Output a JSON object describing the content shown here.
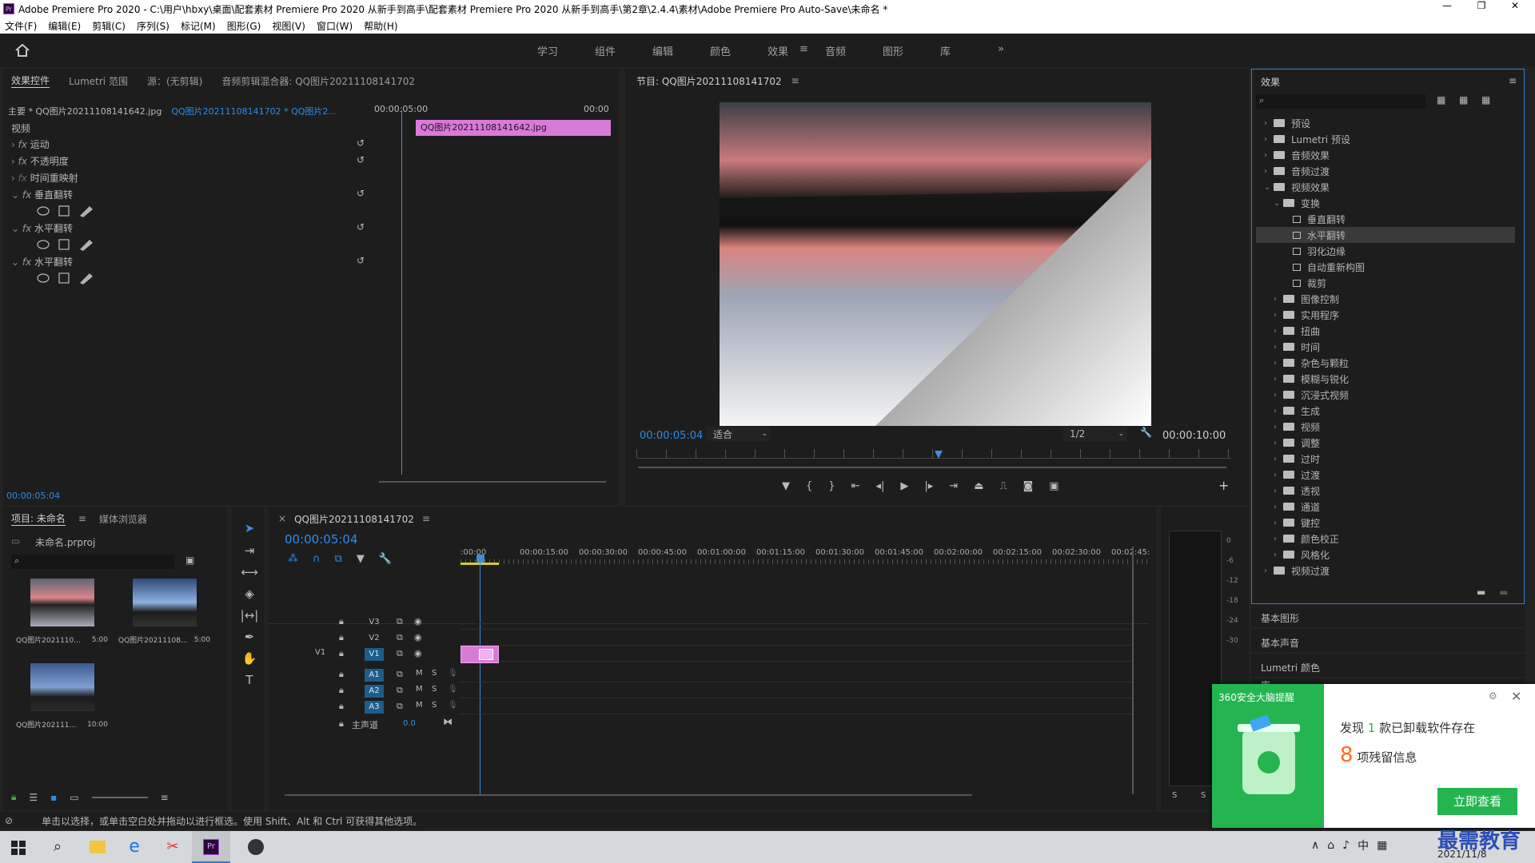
{
  "app": {
    "title": "Adobe Premiere Pro 2020 - C:\\用户\\hbxy\\桌面\\配套素材 Premiere Pro 2020 从新手到高手\\配套素材 Premiere Pro 2020 从新手到高手\\第2章\\2.4.4\\素材\\Adobe Premiere Pro Auto-Save\\未命名 *",
    "icon_label": "Pr"
  },
  "menu": [
    "文件(F)",
    "编辑(E)",
    "剪辑(C)",
    "序列(S)",
    "标记(M)",
    "图形(G)",
    "视图(V)",
    "窗口(W)",
    "帮助(H)"
  ],
  "workspaces": [
    "学习",
    "组件",
    "编辑",
    "颜色",
    "效果",
    "音频",
    "图形",
    "库"
  ],
  "active_workspace": "效果",
  "effect_controls": {
    "tabs": [
      "效果控件",
      "Lumetri 范围",
      "源：(无剪辑)",
      "音频剪辑混合器: QQ图片20211108141702"
    ],
    "master": "主要 * QQ图片20211108141642.jpg",
    "sequence": "QQ图片20211108141702 * QQ图片2...",
    "ruler_start": "00:00:05:00",
    "ruler_end": "00:00",
    "clip_name": "QQ图片20211108141642.jpg",
    "section": "视频",
    "effects": [
      "运动",
      "不透明度",
      "时间重映射",
      "垂直翻转",
      "水平翻转",
      "水平翻转"
    ],
    "timecode": "00:00:05:04"
  },
  "program": {
    "title": "节目: QQ图片20211108141702",
    "timecode": "00:00:05:04",
    "fit": "适合",
    "quality": "1/2",
    "duration": "00:00:10:00",
    "playhead_fraction": 0.508
  },
  "effects_panel": {
    "title": "效果",
    "search_placeholder": "",
    "tree": [
      {
        "label": "预设",
        "level": 0,
        "type": "folder-star"
      },
      {
        "label": "Lumetri 预设",
        "level": 0,
        "type": "folder-star"
      },
      {
        "label": "音频效果",
        "level": 0,
        "type": "folder"
      },
      {
        "label": "音频过渡",
        "level": 0,
        "type": "folder"
      },
      {
        "label": "视频效果",
        "level": 0,
        "type": "folder",
        "open": true
      },
      {
        "label": "变换",
        "level": 1,
        "type": "folder",
        "open": true
      },
      {
        "label": "垂直翻转",
        "level": 2,
        "type": "fx"
      },
      {
        "label": "水平翻转",
        "level": 2,
        "type": "fx",
        "selected": true
      },
      {
        "label": "羽化边缘",
        "level": 2,
        "type": "fx"
      },
      {
        "label": "自动重新构图",
        "level": 2,
        "type": "fx"
      },
      {
        "label": "裁剪",
        "level": 2,
        "type": "fx"
      },
      {
        "label": "图像控制",
        "level": 1,
        "type": "folder"
      },
      {
        "label": "实用程序",
        "level": 1,
        "type": "folder"
      },
      {
        "label": "扭曲",
        "level": 1,
        "type": "folder"
      },
      {
        "label": "时间",
        "level": 1,
        "type": "folder"
      },
      {
        "label": "杂色与颗粒",
        "level": 1,
        "type": "folder"
      },
      {
        "label": "模糊与锐化",
        "level": 1,
        "type": "folder"
      },
      {
        "label": "沉浸式视频",
        "level": 1,
        "type": "folder"
      },
      {
        "label": "生成",
        "level": 1,
        "type": "folder"
      },
      {
        "label": "视频",
        "level": 1,
        "type": "folder"
      },
      {
        "label": "调整",
        "level": 1,
        "type": "folder"
      },
      {
        "label": "过时",
        "level": 1,
        "type": "folder"
      },
      {
        "label": "过渡",
        "level": 1,
        "type": "folder"
      },
      {
        "label": "透视",
        "level": 1,
        "type": "folder"
      },
      {
        "label": "通道",
        "level": 1,
        "type": "folder"
      },
      {
        "label": "键控",
        "level": 1,
        "type": "folder"
      },
      {
        "label": "颜色校正",
        "level": 1,
        "type": "folder"
      },
      {
        "label": "风格化",
        "level": 1,
        "type": "folder"
      },
      {
        "label": "视频过渡",
        "level": 0,
        "type": "folder"
      }
    ],
    "collapsed_panels": [
      "基本图形",
      "基本声音",
      "Lumetri 颜色",
      "库"
    ]
  },
  "project": {
    "tabs": [
      "项目: 未命名",
      "媒体浏览器"
    ],
    "file": "未命名.prproj",
    "items": [
      {
        "name": "QQ图片2021110...",
        "duration": "5:00"
      },
      {
        "name": "QQ图片20211108...",
        "duration": "5:00"
      },
      {
        "name": "QQ图片202111...",
        "duration": "10:00"
      }
    ]
  },
  "timeline": {
    "title": "QQ图片20211108141702",
    "timecode": "00:00:05:04",
    "ruler": [
      ":00:00",
      "00:00:15:00",
      "00:00:30:00",
      "00:00:45:00",
      "00:01:00:00",
      "00:01:15:00",
      "00:01:30:00",
      "00:01:45:00",
      "00:02:00:00",
      "00:02:15:00",
      "00:02:30:00",
      "00:02:45:"
    ],
    "video_tracks": [
      "V3",
      "V2",
      "V1"
    ],
    "audio_tracks": [
      "A1",
      "A2",
      "A3"
    ],
    "source_patch": "V1",
    "master_label": "主声道",
    "master_value": "0.0",
    "track_flags": [
      "M",
      "S"
    ]
  },
  "meter": {
    "scale": [
      "0",
      "-6",
      "-12",
      "-18",
      "-24",
      "-30"
    ],
    "labels": [
      "S",
      "S"
    ]
  },
  "status_bar": "单击以选择，或单击空白处并拖动以进行框选。使用 Shift、Alt 和 Ctrl 可获得其他选项。",
  "popup": {
    "brand": "360安全大脑提醒",
    "line1_pre": "发现",
    "line1_num": "1",
    "line1_post": "款已卸载软件存在",
    "line2_num": "8",
    "line2_post": "项残留信息",
    "button": "立即查看"
  },
  "taskbar": {
    "tray_text": "中",
    "date": "2021/11/8",
    "watermark": "最需教育"
  }
}
